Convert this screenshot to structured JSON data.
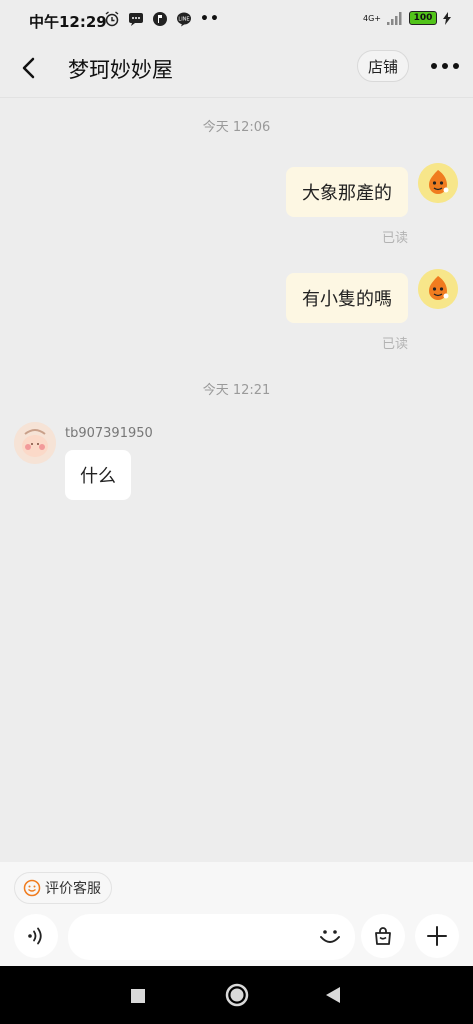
{
  "status_bar": {
    "time": "中午12:29",
    "network": "4G+",
    "battery": "100"
  },
  "header": {
    "title": "梦珂妙妙屋",
    "shop_label": "店铺"
  },
  "messages": {
    "ts1": "今天  12:06",
    "m1": "大象那產的",
    "read1": "已读",
    "m2": "有小隻的嗎",
    "read2": "已读",
    "ts2": "今天  12:21",
    "sender": "tb907391950",
    "m3": "什么"
  },
  "bottom": {
    "rate_label": "评价客服"
  },
  "colors": {
    "background": "#ededed",
    "my_bubble": "#fdf7e3",
    "their_bubble": "#ffffff",
    "accent_orange": "#f07c1f"
  }
}
